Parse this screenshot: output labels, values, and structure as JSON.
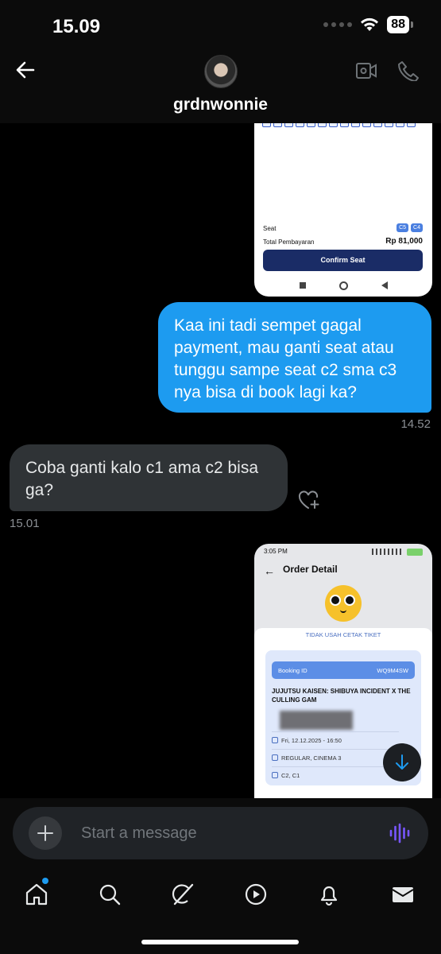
{
  "status_bar": {
    "time": "15.09",
    "battery": "88"
  },
  "header": {
    "username": "grdnwonnie"
  },
  "attachment_1": {
    "seat_label": "Seat",
    "seat_chips": [
      "C5",
      "C4"
    ],
    "total_label": "Total Pembayaran",
    "total_value": "Rp 81,000",
    "confirm_label": "Confirm Seat"
  },
  "messages": {
    "outgoing_text": "Kaa ini tadi sempet gagal payment, mau ganti seat atau tunggu sampe seat c2 sma c3 nya bisa di book lagi ka?",
    "outgoing_time": "14.52",
    "incoming_text": "Coba ganti kalo c1 ama c2 bisa ga?",
    "incoming_time": "15.01"
  },
  "attachment_2": {
    "status_time": "3:05 PM",
    "title": "Order Detail",
    "hint": "TIDAK USAH CETAK TIKET",
    "booking_label": "Booking ID",
    "booking_id": "WQ9M4SW",
    "movie": "JUJUTSU KAISEN: SHIBUYA INCIDENT X THE CULLING GAM",
    "date": "Fri, 12.12.2025 - 16:50",
    "cinema": "REGULAR, CINEMA 3",
    "seats": "C2, C1"
  },
  "composer": {
    "placeholder": "Start a message"
  },
  "colors": {
    "accent": "#1d9bf0",
    "incoming_bubble": "#2f3336",
    "background": "#000000"
  },
  "icons": [
    "back-arrow-icon",
    "video-call-icon",
    "phone-icon",
    "heart-add-icon",
    "plus-icon",
    "voice-icon",
    "home-icon",
    "search-icon",
    "grok-icon",
    "play-icon",
    "bell-icon",
    "mail-icon",
    "scroll-down-icon"
  ]
}
